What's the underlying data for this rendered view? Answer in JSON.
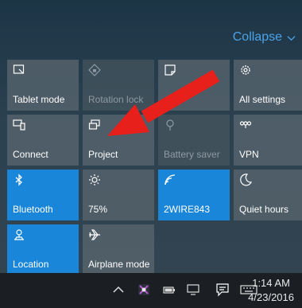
{
  "header": {
    "collapse_label": "Collapse"
  },
  "tiles": [
    {
      "label": "Tablet mode",
      "icon": "tablet-mode-icon",
      "state": "normal"
    },
    {
      "label": "Rotation lock",
      "icon": "rotation-lock-icon",
      "state": "disabled"
    },
    {
      "label": "",
      "icon": "note-icon",
      "state": "normal"
    },
    {
      "label": "All settings",
      "icon": "gear-icon",
      "state": "normal"
    },
    {
      "label": "Connect",
      "icon": "connect-icon",
      "state": "normal"
    },
    {
      "label": "Project",
      "icon": "project-icon",
      "state": "normal"
    },
    {
      "label": "Battery saver",
      "icon": "battery-saver-icon",
      "state": "disabled"
    },
    {
      "label": "VPN",
      "icon": "vpn-icon",
      "state": "normal"
    },
    {
      "label": "Bluetooth",
      "icon": "bluetooth-icon",
      "state": "on"
    },
    {
      "label": "75%",
      "icon": "brightness-icon",
      "state": "normal"
    },
    {
      "label": "2WIRE843",
      "icon": "wifi-icon",
      "state": "on"
    },
    {
      "label": "Quiet hours",
      "icon": "moon-icon",
      "state": "normal"
    },
    {
      "label": "Location",
      "icon": "location-icon",
      "state": "on"
    },
    {
      "label": "Airplane mode",
      "icon": "airplane-icon",
      "state": "normal"
    }
  ],
  "taskbar": {
    "time": "1:14 AM",
    "date": "4/23/2016"
  },
  "colors": {
    "accent": "#1a86d9",
    "arrow": "#e8201c",
    "collapse": "#4aa3e8"
  }
}
